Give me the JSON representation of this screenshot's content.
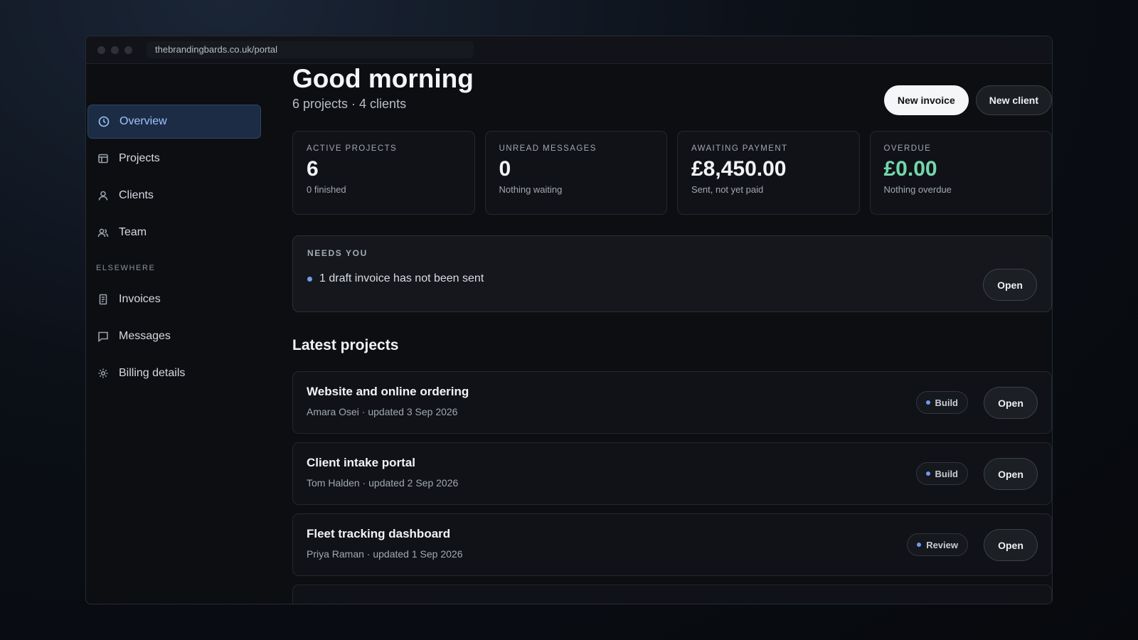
{
  "browser": {
    "url": "thebrandingbards.co.uk/portal"
  },
  "sidebar": {
    "items": [
      {
        "label": "Overview",
        "icon": "clock-icon",
        "active": true
      },
      {
        "label": "Projects",
        "icon": "layout-icon"
      },
      {
        "label": "Clients",
        "icon": "user-icon"
      },
      {
        "label": "Team",
        "icon": "users-icon"
      }
    ],
    "section_label": "ELSEWHERE",
    "elsewhere": [
      {
        "label": "Invoices",
        "icon": "receipt-icon"
      },
      {
        "label": "Messages",
        "icon": "chat-icon"
      },
      {
        "label": "Billing details",
        "icon": "gear-icon"
      }
    ]
  },
  "header": {
    "greeting": "Good morning",
    "subline": "6 projects · 4 clients",
    "new_invoice_label": "New invoice",
    "new_client_label": "New client"
  },
  "stats": [
    {
      "label": "ACTIVE PROJECTS",
      "value": "6",
      "note": "0 finished"
    },
    {
      "label": "UNREAD MESSAGES",
      "value": "0",
      "note": "Nothing waiting"
    },
    {
      "label": "AWAITING PAYMENT",
      "value": "£8,450.00",
      "note": "Sent, not yet paid"
    },
    {
      "label": "OVERDUE",
      "value": "£0.00",
      "note": "Nothing overdue",
      "color": "#74d6ad"
    }
  ],
  "needs_you": {
    "label": "NEEDS YOU",
    "item": "1 draft invoice has not been sent",
    "open_label": "Open"
  },
  "latest_projects": {
    "title": "Latest projects",
    "items": [
      {
        "name": "Website and online ordering",
        "meta": "Amara Osei · updated 3 Sep 2026",
        "status": "Build",
        "open_label": "Open"
      },
      {
        "name": "Client intake portal",
        "meta": "Tom Halden · updated 2 Sep 2026",
        "status": "Build",
        "open_label": "Open"
      },
      {
        "name": "Fleet tracking dashboard",
        "meta": "Priya Raman · updated 1 Sep 2026",
        "status": "Review",
        "open_label": "Open"
      }
    ]
  },
  "colors": {
    "accent": "#9fc4ff",
    "bullet": "#6f9cf0",
    "positive": "#74d6ad"
  }
}
